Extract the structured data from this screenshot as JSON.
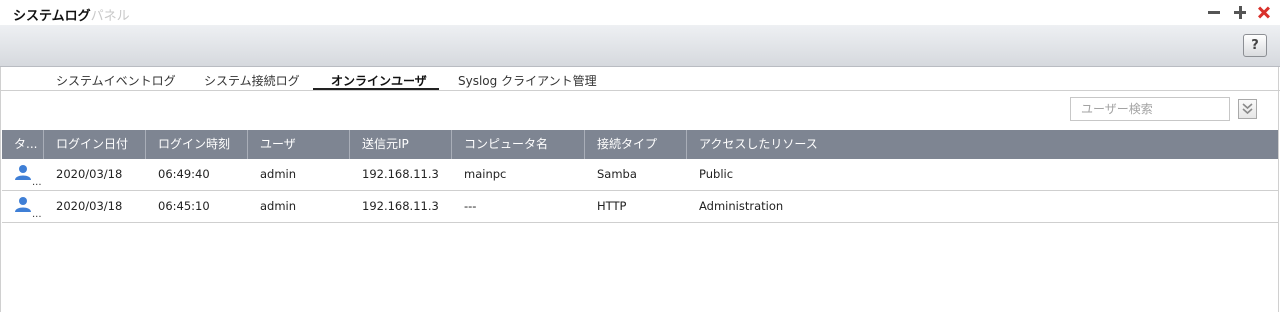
{
  "window": {
    "title": "システムログ",
    "title_ghost": "パネル",
    "controls": [
      "minimize-icon",
      "maximize-icon",
      "close-icon"
    ],
    "close_color": "#d9312b"
  },
  "toolbar": {
    "help_label": "?"
  },
  "tabs": [
    {
      "label": "システムイベントログ",
      "active": false
    },
    {
      "label": "システム接続ログ",
      "active": false
    },
    {
      "label": "オンラインユーザ",
      "active": true
    },
    {
      "label": "Syslog クライアント管理",
      "active": false
    }
  ],
  "search": {
    "placeholder": "ユーザー検索",
    "value": ""
  },
  "table": {
    "columns": [
      "タ...",
      "ログイン日付",
      "ログイン時刻",
      "ユーザ",
      "送信元IP",
      "コンピュータ名",
      "接続タイプ",
      "アクセスしたリソース"
    ],
    "rows": [
      {
        "type_icon": "user-icon",
        "type_more": "...",
        "date": "2020/03/18",
        "time": "06:49:40",
        "user": "admin",
        "ip": "192.168.11.3",
        "computer": "mainpc",
        "conn_type": "Samba",
        "resource": "Public"
      },
      {
        "type_icon": "user-icon",
        "type_more": "...",
        "date": "2020/03/18",
        "time": "06:45:10",
        "user": "admin",
        "ip": "192.168.11.3",
        "computer": "---",
        "conn_type": "HTTP",
        "resource": "Administration"
      }
    ],
    "header_color": "#7e8592",
    "icon_color": "#3f7fd6"
  }
}
